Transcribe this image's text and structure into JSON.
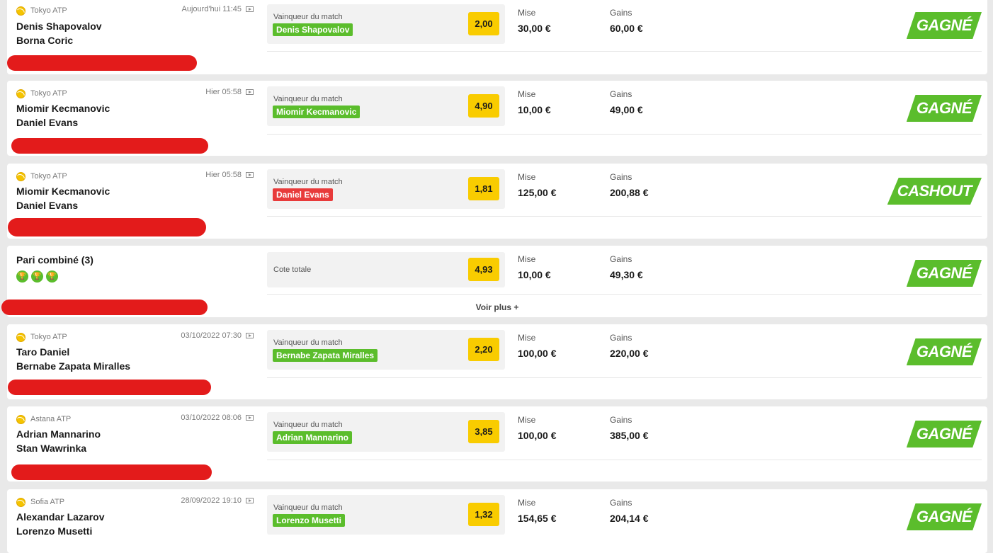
{
  "bets": [
    {
      "league": "Tokyo ATP",
      "date": "Aujourd'hui 11:45",
      "player1": "Denis Shapovalov",
      "player2": "Borna Coric",
      "market": "Vainqueur du match",
      "pick": "Denis Shapovalov",
      "pick_status": "won",
      "odds": "2,00",
      "stake_label": "Mise",
      "stake": "30,00 €",
      "gains_label": "Gains",
      "gains": "60,00 €",
      "result": "GAGNÉ"
    },
    {
      "league": "Tokyo ATP",
      "date": "Hier 05:58",
      "player1": "Miomir Kecmanovic",
      "player2": "Daniel Evans",
      "market": "Vainqueur du match",
      "pick": "Miomir Kecmanovic",
      "pick_status": "won",
      "odds": "4,90",
      "stake_label": "Mise",
      "stake": "10,00 €",
      "gains_label": "Gains",
      "gains": "49,00 €",
      "result": "GAGNÉ"
    },
    {
      "league": "Tokyo ATP",
      "date": "Hier 05:58",
      "player1": "Miomir Kecmanovic",
      "player2": "Daniel Evans",
      "market": "Vainqueur du match",
      "pick": "Daniel Evans",
      "pick_status": "lost",
      "odds": "1,81",
      "stake_label": "Mise",
      "stake": "125,00 €",
      "gains_label": "Gains",
      "gains": "200,88 €",
      "result": "CASHOUT"
    },
    {
      "combo_title": "Pari combiné (3)",
      "market": "Cote totale",
      "odds": "4,93",
      "stake_label": "Mise",
      "stake": "10,00 €",
      "gains_label": "Gains",
      "gains": "49,30 €",
      "result": "GAGNÉ",
      "more": "Voir plus +"
    },
    {
      "league": "Tokyo ATP",
      "date": "03/10/2022 07:30",
      "player1": "Taro Daniel",
      "player2": "Bernabe Zapata Miralles",
      "market": "Vainqueur du match",
      "pick": "Bernabe Zapata Miralles",
      "pick_status": "won",
      "odds": "2,20",
      "stake_label": "Mise",
      "stake": "100,00 €",
      "gains_label": "Gains",
      "gains": "220,00 €",
      "result": "GAGNÉ"
    },
    {
      "league": "Astana ATP",
      "date": "03/10/2022 08:06",
      "player1": "Adrian Mannarino",
      "player2": "Stan Wawrinka",
      "market": "Vainqueur du match",
      "pick": "Adrian Mannarino",
      "pick_status": "won",
      "odds": "3,85",
      "stake_label": "Mise",
      "stake": "100,00 €",
      "gains_label": "Gains",
      "gains": "385,00 €",
      "result": "GAGNÉ"
    },
    {
      "league": "Sofia ATP",
      "date": "28/09/2022 19:10",
      "player1": "Alexandar Lazarov",
      "player2": "Lorenzo Musetti",
      "market": "Vainqueur du match",
      "pick": "Lorenzo Musetti",
      "pick_status": "won",
      "odds": "1,32",
      "stake_label": "Mise",
      "stake": "154,65 €",
      "gains_label": "Gains",
      "gains": "204,14 €",
      "result": "GAGNÉ"
    }
  ],
  "colors": {
    "won": "#5bbd2c",
    "lost": "#e83b3b",
    "odds": "#f9cc00",
    "redaction": "#e31b1b"
  },
  "icons": {
    "sport": "tennis-ball-icon",
    "video": "video-icon",
    "combo_leg": "trophy-icon"
  }
}
